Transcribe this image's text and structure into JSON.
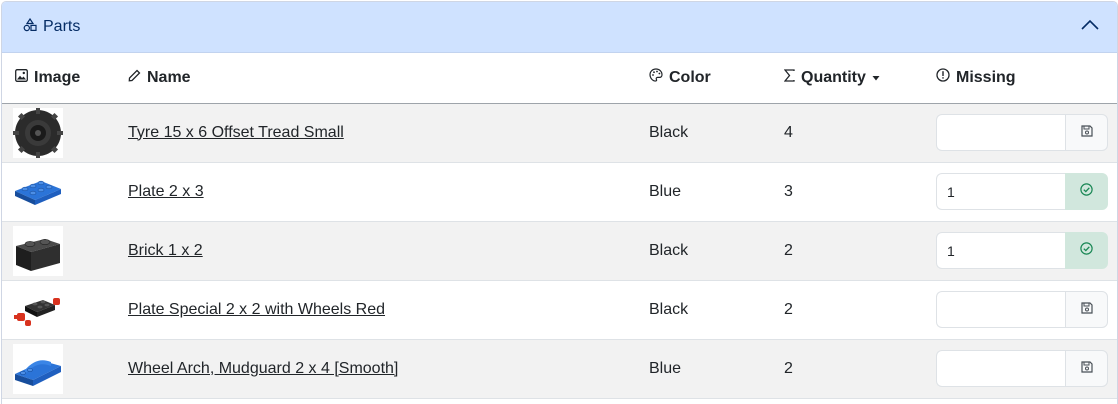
{
  "panel": {
    "title": "Parts"
  },
  "columns": {
    "image": "Image",
    "name": "Name",
    "color": "Color",
    "quantity": "Quantity",
    "missing": "Missing"
  },
  "rows": [
    {
      "name": "Tyre 15 x 6 Offset Tread Small",
      "color": "Black",
      "quantity": "4",
      "missing": "",
      "status": "save"
    },
    {
      "name": "Plate 2 x 3",
      "color": "Blue",
      "quantity": "3",
      "missing": "1",
      "status": "saved"
    },
    {
      "name": "Brick 1 x 2",
      "color": "Black",
      "quantity": "2",
      "missing": "1",
      "status": "saved"
    },
    {
      "name": "Plate Special 2 x 2 with Wheels Red",
      "color": "Black",
      "quantity": "2",
      "missing": "",
      "status": "save"
    },
    {
      "name": "Wheel Arch, Mudguard 2 x 4 [Smooth]",
      "color": "Blue",
      "quantity": "2",
      "missing": "",
      "status": "save"
    }
  ],
  "colors": {
    "header_bg": "#cfe2ff",
    "header_text": "#052c65",
    "success_bg": "#d1e7dd",
    "success_icon": "#198754",
    "part_black": "#2b2b2b",
    "part_blue": "#1f5fbf",
    "part_red": "#d8321e"
  },
  "icons": {
    "panel": "shapes-icon",
    "collapse": "chevron-up-icon",
    "image_col": "image-icon",
    "name_col": "pencil-icon",
    "color_col": "palette-icon",
    "quantity_col": "sigma-icon",
    "quantity_sort": "caret-down-icon",
    "missing_col": "exclamation-circle-icon",
    "save": "floppy-disk-icon",
    "saved": "check-circle-icon"
  }
}
